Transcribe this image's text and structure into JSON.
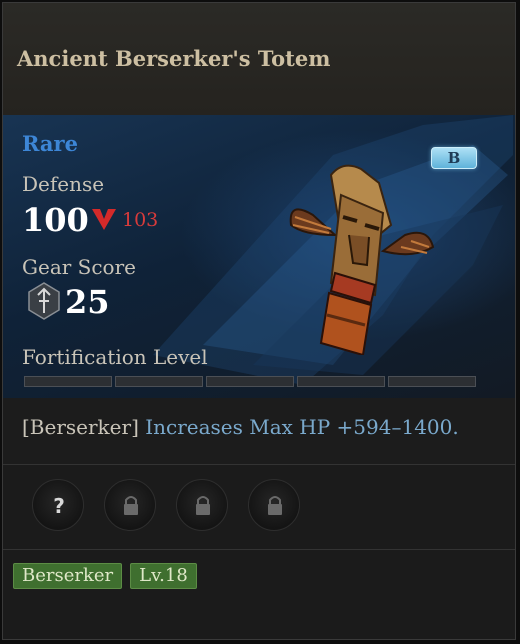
{
  "item": {
    "name": "Ancient Berserker's Totem",
    "rarity": "Rare",
    "grade": "B"
  },
  "stats": {
    "defense_label": "Defense",
    "defense_value": "100",
    "defense_compare": "103",
    "gear_score_label": "Gear Score",
    "gear_score_value": "25",
    "fortification_label": "Fortification Level",
    "fortification_segments": 5,
    "fortification_filled": 0
  },
  "description": {
    "class_tag": "[Berserker]",
    "effect": "Increases Max HP +594–1400."
  },
  "sockets": [
    {
      "state": "unknown",
      "icon": "question-icon"
    },
    {
      "state": "locked",
      "icon": "lock-icon"
    },
    {
      "state": "locked",
      "icon": "lock-icon"
    },
    {
      "state": "locked",
      "icon": "lock-icon"
    }
  ],
  "tags": {
    "class": "Berserker",
    "level": "Lv.18"
  },
  "colors": {
    "rarity": "#3d86d6",
    "compare_worse": "#d83b3b",
    "effect_text": "#7aa9cc",
    "tag_bg": "#3f6f2f"
  }
}
